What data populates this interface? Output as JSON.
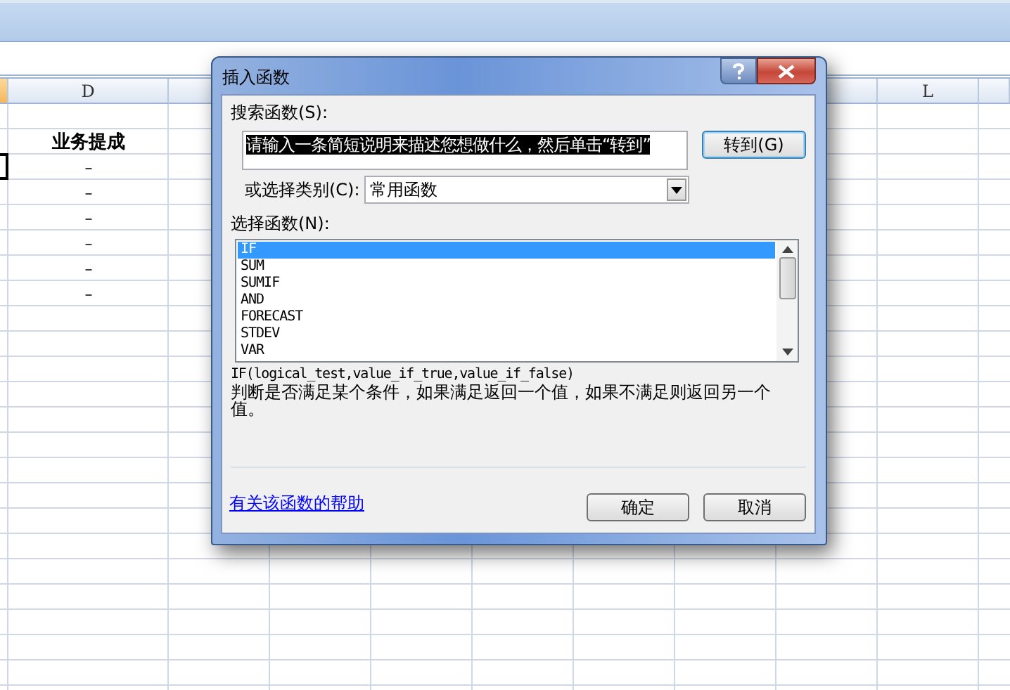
{
  "sheet": {
    "column_headers": [
      "D",
      "L"
    ],
    "column_d_cells": [
      "业务提成",
      "–",
      "–",
      "–",
      "–",
      "–",
      "–"
    ]
  },
  "dialog": {
    "title": "插入函数",
    "search": {
      "label": "搜索函数(S):",
      "value": "请输入一条简短说明来描述您想做什么，然后单击“转到”",
      "selected": true
    },
    "go_button": "转到(G)",
    "category": {
      "label": "或选择类别(C):",
      "value": "常用函数"
    },
    "functions_label": "选择函数(N):",
    "functions": [
      {
        "name": "IF",
        "selected": true
      },
      {
        "name": "SUM",
        "selected": false
      },
      {
        "name": "SUMIF",
        "selected": false
      },
      {
        "name": "AND",
        "selected": false
      },
      {
        "name": "FORECAST",
        "selected": false
      },
      {
        "name": "STDEV",
        "selected": false
      },
      {
        "name": "VAR",
        "selected": false
      }
    ],
    "signature": "IF(logical_test,value_if_true,value_if_false)",
    "description": "判断是否满足某个条件，如果满足返回一个值，如果不满足则返回另一个值。",
    "help_link": "有关该函数的帮助",
    "buttons": [
      "确定",
      "取消"
    ]
  }
}
